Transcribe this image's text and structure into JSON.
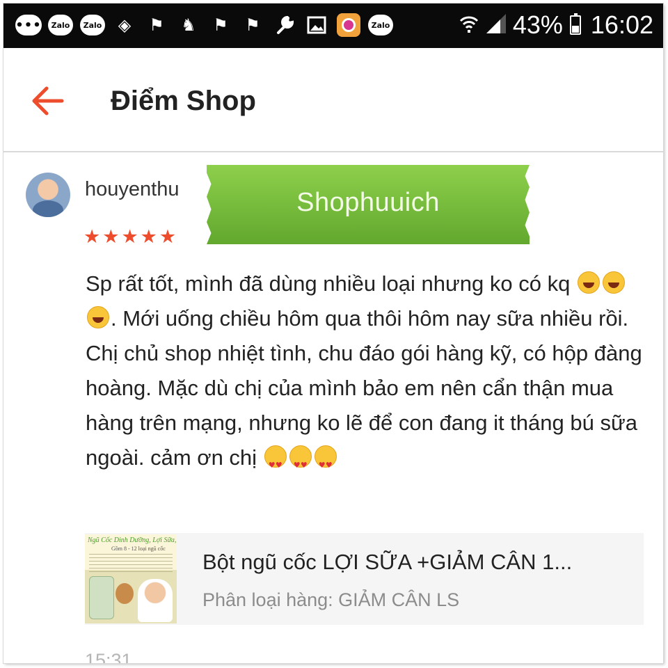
{
  "status_bar": {
    "left_icons": [
      "more-icon",
      "zalo-icon",
      "zalo-icon",
      "currency-icon",
      "flag-icon",
      "person-icon",
      "flag-icon",
      "flag-icon",
      "wrench-icon",
      "image-icon",
      "camera-app-icon",
      "zalo-icon"
    ],
    "zalo_label": "Zalo",
    "battery_percent": "43%",
    "time": "16:02"
  },
  "header": {
    "title": "Điểm Shop",
    "accent_color": "#ee4d2d"
  },
  "review": {
    "username": "houyenthu",
    "rating": 5,
    "watermark_text": "Shophuuich",
    "text_parts": [
      "Sp rất tốt, mình đã dùng nhiều loại nhưng ko có kq ",
      ". Mới uống chiều hôm qua thôi hôm nay sữa nhiều rồi. Chị chủ shop nhiệt tình, chu đáo gói hàng kỹ, có hộp đàng hoàng. Mặc dù chị của mình bảo em nên cẩn thận mua hàng trên mạng, nhưng ko lẽ để con đang it tháng bú sữa ngoài. cảm ơn chị "
    ],
    "emoji_groups": [
      "face-with-tears-of-joy x3",
      "smiling-face-with-heart-eyes x3"
    ],
    "timestamp": "15:31"
  },
  "product": {
    "name": "Bột ngũ cốc LỢI SỮA +GIẢM CÂN 1...",
    "variant": "Phân loại hàng: GIẢM CÂN LS",
    "thumb_title": "Ngũ Cốc Dinh Dưỡng, Lợi Sữa, Giảm Cân",
    "thumb_subtitle": "Gồm 8 - 12 loại ngũ cốc"
  }
}
